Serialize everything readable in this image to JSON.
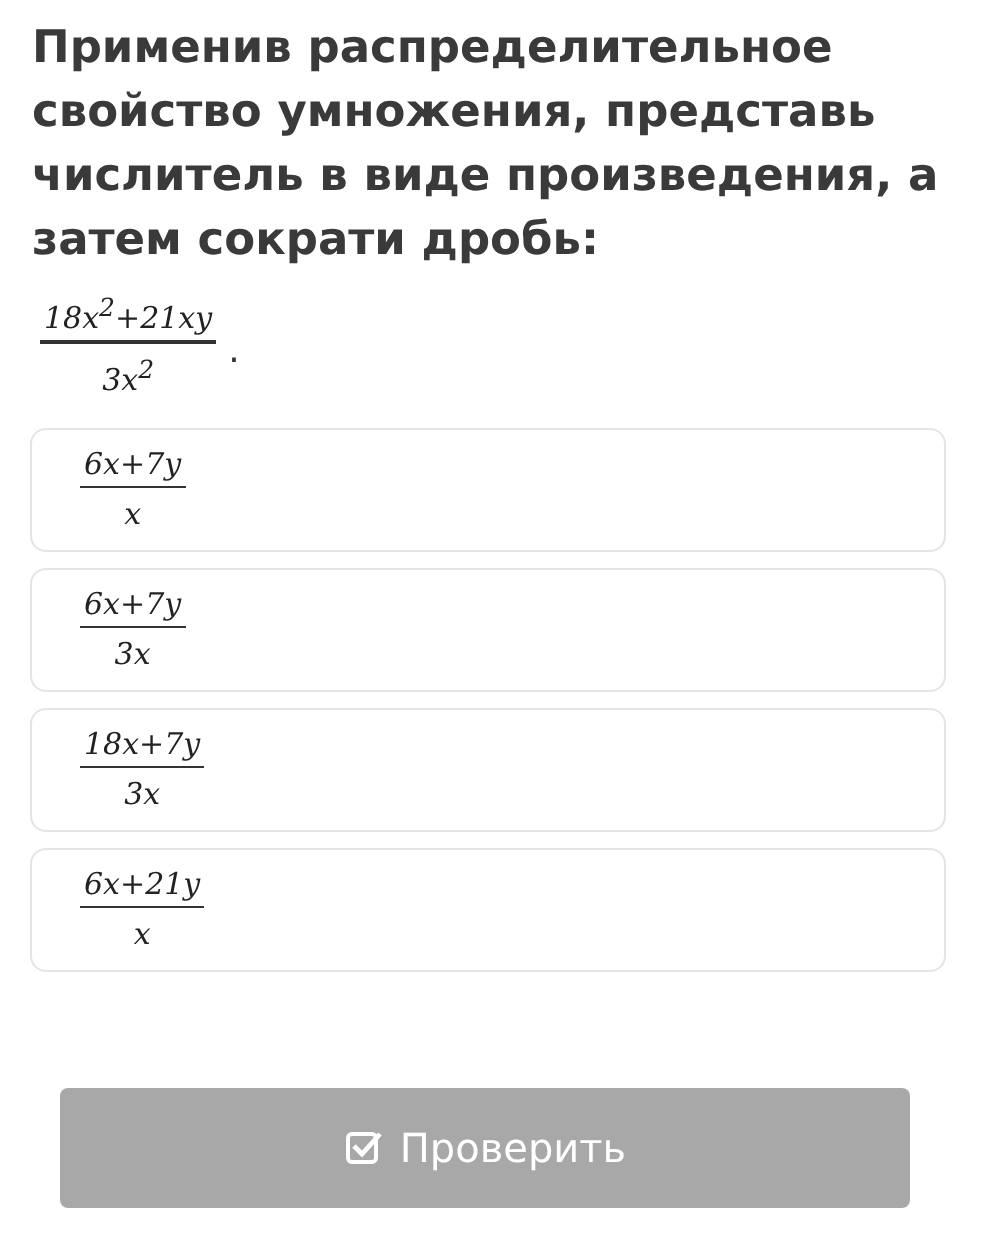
{
  "question": "Применив распределительное свойство умножения, представь числитель в виде произведения, а затем сократи дробь:",
  "expression": {
    "numerator": "18x$^{2}$+21xy",
    "denominator": "3x$^{2}$",
    "suffix": "."
  },
  "options": [
    {
      "numerator": "6x+7y",
      "denominator": "x",
      "selected": false
    },
    {
      "numerator": "6x+7y",
      "denominator": "3x",
      "selected": false
    },
    {
      "numerator": "18x+7y",
      "denominator": "3x",
      "selected": false
    },
    {
      "numerator": "6x+21y",
      "denominator": "x",
      "selected": false
    }
  ],
  "check_button": {
    "label": "Проверить",
    "disabled": true
  }
}
